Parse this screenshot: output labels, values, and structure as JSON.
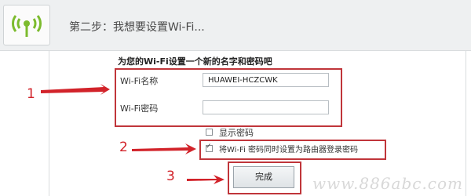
{
  "header": {
    "step_title": "第二步：我想要设置Wi-Fi..."
  },
  "form": {
    "heading": "为您的Wi-Fi设置一个新的名字和密码吧",
    "wifi_name_label": "Wi-Fi名称",
    "wifi_name_value": "HUAWEI-HCZCWK",
    "wifi_password_label": "Wi-Fi密码",
    "wifi_password_value": "",
    "show_password_label": "显示密码",
    "show_password_checked": false,
    "same_password_label": "将Wi-Fi 密码同时设置为路由器登录密码",
    "same_password_checked": true,
    "done_label": "完成"
  },
  "annotations": {
    "n1": "1",
    "n2": "2",
    "n3": "3",
    "color": "#d2232a"
  },
  "watermark": "www.886abc.com",
  "icons": {
    "logo": "wifi-icon",
    "arrows": "red-arrow-icon"
  }
}
